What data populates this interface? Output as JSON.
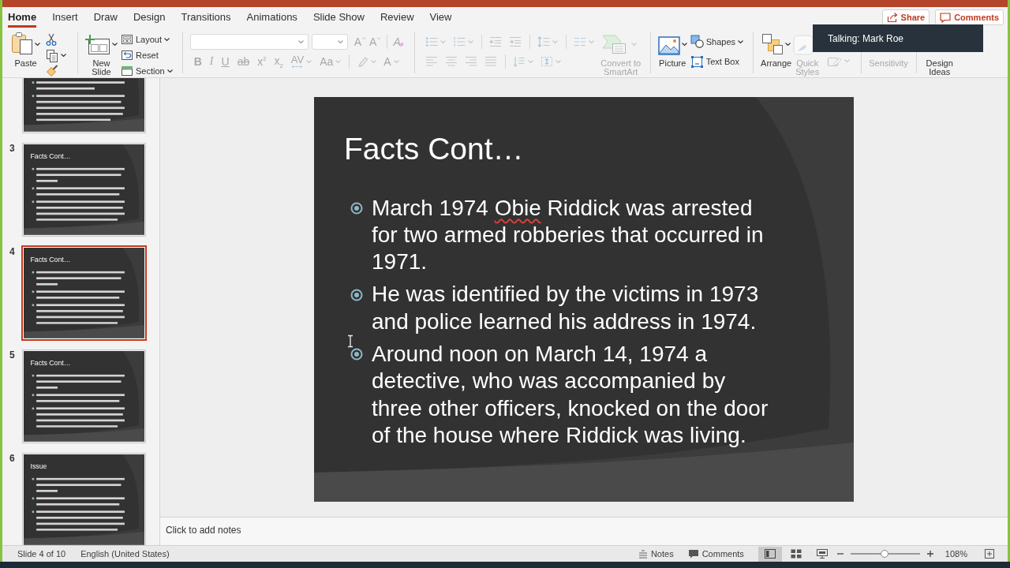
{
  "ribbon": {
    "tabs": [
      {
        "label": "Home",
        "selected": true
      },
      {
        "label": "Insert",
        "selected": false
      },
      {
        "label": "Draw",
        "selected": false
      },
      {
        "label": "Design",
        "selected": false
      },
      {
        "label": "Transitions",
        "selected": false
      },
      {
        "label": "Animations",
        "selected": false
      },
      {
        "label": "Slide Show",
        "selected": false
      },
      {
        "label": "Review",
        "selected": false
      },
      {
        "label": "View",
        "selected": false
      }
    ],
    "share_button": {
      "label": "Share"
    },
    "comments_button": {
      "label": "Comments"
    },
    "groups": [
      {
        "parts": [
          {
            "kind": "paste",
            "label": "Paste",
            "dropdown": true,
            "disabled": false
          },
          {
            "rows": [
              [
                {
                  "kind": "cut",
                  "dropdown": false,
                  "disabled": false
                }
              ],
              [
                {
                  "kind": "copy",
                  "dropdown": true,
                  "disabled": false
                }
              ],
              [
                {
                  "kind": "format-painter",
                  "dropdown": false,
                  "disabled": false
                }
              ]
            ]
          }
        ]
      },
      {
        "parts": [
          {
            "kind": "new-slide",
            "label": "New Slide",
            "dropdown": true,
            "disabled": false
          },
          {
            "rows": [
              [
                {
                  "kind": "layout",
                  "label": "Layout",
                  "dropdown": true,
                  "disabled": false
                }
              ],
              [
                {
                  "kind": "reset",
                  "label": "Reset",
                  "dropdown": false,
                  "disabled": false
                }
              ],
              [
                {
                  "kind": "section",
                  "label": "Section",
                  "dropdown": true,
                  "disabled": false
                }
              ]
            ]
          }
        ]
      },
      {
        "parts": [
          {
            "rows": [
              [
                {
                  "kind": "font-name",
                  "dropdown": true,
                  "disabled": true
                },
                {
                  "kind": "font-size",
                  "dropdown": true,
                  "disabled": true
                },
                {
                  "kind": "grow-font",
                  "label": "A",
                  "dropdown": false,
                  "disabled": true
                },
                {
                  "kind": "shrink-font",
                  "label": "A",
                  "dropdown": false,
                  "disabled": true
                },
                {
                  "kind": "separator"
                },
                {
                  "kind": "clear-formatting",
                  "label": "A",
                  "dropdown": false,
                  "disabled": true
                }
              ],
              [
                {
                  "kind": "bold",
                  "label": "B",
                  "dropdown": false,
                  "disabled": true
                },
                {
                  "kind": "italic",
                  "label": "I",
                  "dropdown": false,
                  "disabled": true
                },
                {
                  "kind": "underline",
                  "label": "U",
                  "dropdown": false,
                  "disabled": true
                },
                {
                  "kind": "strikethrough",
                  "label": "ab",
                  "dropdown": false,
                  "disabled": true
                },
                {
                  "kind": "superscript",
                  "label": "x$^{2}$",
                  "dropdown": false,
                  "disabled": true
                },
                {
                  "kind": "subscript",
                  "label": "x$_{2}$",
                  "dropdown": false,
                  "disabled": true
                },
                {
                  "kind": "character-spacing",
                  "label": "AV",
                  "dropdown": true,
                  "disabled": true
                },
                {
                  "kind": "change-case",
                  "label": "Aa",
                  "dropdown": true,
                  "disabled": true
                },
                {
                  "kind": "separator"
                },
                {
                  "kind": "highlight",
                  "dropdown": true,
                  "disabled": true
                },
                {
                  "kind": "font-color",
                  "label": "A",
                  "dropdown": true,
                  "disabled": true
                }
              ]
            ]
          }
        ]
      },
      {
        "parts": [
          {
            "rows": [
              [
                {
                  "kind": "bullets",
                  "dropdown": true,
                  "disabled": true
                },
                {
                  "kind": "numbering",
                  "dropdown": true,
                  "disabled": true
                },
                {
                  "kind": "separator"
                },
                {
                  "kind": "decrease-indent",
                  "dropdown": false,
                  "disabled": true
                },
                {
                  "kind": "increase-indent",
                  "dropdown": false,
                  "disabled": true
                },
                {
                  "kind": "separator"
                },
                {
                  "kind": "line-spacing",
                  "dropdown": true,
                  "disabled": true
                },
                {
                  "kind": "separator"
                },
                {
                  "kind": "columns",
                  "dropdown": true,
                  "disabled": true
                }
              ],
              [
                {
                  "kind": "align-left",
                  "dropdown": false,
                  "disabled": true
                },
                {
                  "kind": "align-center",
                  "dropdown": false,
                  "disabled": true
                },
                {
                  "kind": "align-right",
                  "dropdown": false,
                  "disabled": true
                },
                {
                  "kind": "justify",
                  "dropdown": false,
                  "disabled": true
                },
                {
                  "kind": "separator"
                },
                {
                  "kind": "text-direction",
                  "dropdown": true,
                  "disabled": true
                },
                {
                  "kind": "align-text",
                  "dropdown": true,
                  "disabled": true
                }
              ]
            ]
          },
          {
            "kind": "smartart",
            "label": "Convert to SmartArt",
            "dropdown": true,
            "disabled": true
          }
        ]
      },
      {
        "parts": [
          {
            "kind": "picture",
            "label": "Picture",
            "dropdown": true,
            "disabled": false
          },
          {
            "rows": [
              [
                {
                  "kind": "shapes",
                  "label": "Shapes",
                  "dropdown": true,
                  "disabled": false
                }
              ],
              [
                {
                  "kind": "text-box",
                  "label": "Text Box",
                  "dropdown": false,
                  "disabled": false
                }
              ]
            ]
          }
        ]
      },
      {
        "parts": [
          {
            "kind": "arrange",
            "label": "Arrange",
            "dropdown": true,
            "disabled": false
          },
          {
            "kind": "quick-styles",
            "label": "Quick Styles",
            "dropdown": false,
            "disabled": true
          },
          {
            "rows": [
              [
                {
                  "kind": "shape-outline",
                  "dropdown": true,
                  "disabled": true
                }
              ]
            ]
          }
        ]
      },
      {
        "parts": [
          {
            "kind": "sensitivity",
            "label": "Sensitivity",
            "dropdown": false,
            "disabled": true
          }
        ]
      },
      {
        "parts": [
          {
            "kind": "design-ideas",
            "label": "Design Ideas",
            "dropdown": false,
            "disabled": false
          }
        ]
      }
    ]
  },
  "talking_indicator": {
    "text": "Talking: Mark Roe"
  },
  "thumbnails": [
    {
      "selected": false
    },
    {
      "number": "3",
      "title": "Facts Cont…",
      "selected": false
    },
    {
      "number": "4",
      "title": "Facts Cont…",
      "selected": true
    },
    {
      "number": "5",
      "title": "Facts Cont…",
      "selected": false
    },
    {
      "number": "6",
      "title": "Issue",
      "selected": false
    }
  ],
  "slide": {
    "title": "Facts Cont…",
    "bullets": [
      {
        "segments": [
          {
            "text": "March 1974 ",
            "misspelled": false
          },
          {
            "text": "Obie",
            "misspelled": true
          },
          {
            "text": " Riddick was arrested for two armed robberies that occurred in 1971.",
            "misspelled": false
          }
        ]
      },
      {
        "segments": [
          {
            "text": "He was identified by the victims in 1973 and police learned his address in 1974.",
            "misspelled": false
          }
        ]
      },
      {
        "segments": [
          {
            "text": "Around noon on March 14, 1974 a detective, who was accompanied by three other officers, knocked on the door of the house where Riddick was living.",
            "misspelled": false
          }
        ]
      }
    ]
  },
  "notes": {
    "placeholder": "Click to add notes"
  },
  "status_bar": {
    "slide_position": "Slide 4 of 10",
    "language": "English (United States)",
    "notes_button": {
      "label": "Notes"
    },
    "comments_button": {
      "label": "Comments"
    },
    "views": [
      {
        "kind": "normal",
        "selected": true
      },
      {
        "kind": "slide-sorter",
        "selected": false
      },
      {
        "kind": "reading",
        "selected": false
      }
    ],
    "zoom": {
      "level": 0.49,
      "reading": "108%"
    }
  }
}
